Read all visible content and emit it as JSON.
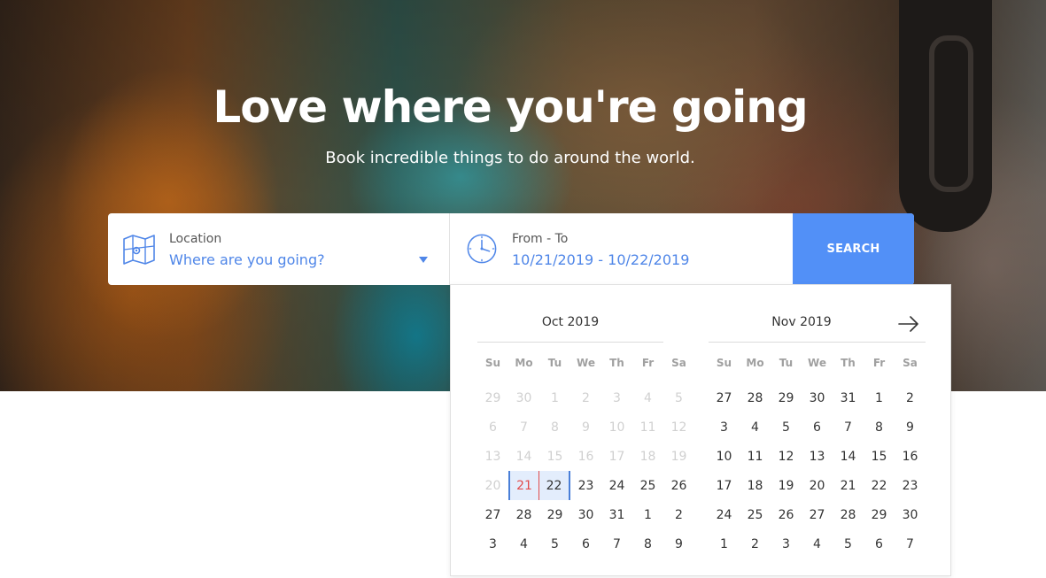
{
  "hero": {
    "title": "Love where you're going",
    "subtitle": "Book incredible things to do around the world."
  },
  "search": {
    "location_label": "Location",
    "location_placeholder": "Where are you going?",
    "location_icon": "map-icon",
    "dates_label": "From - To",
    "dates_value": "10/21/2019 - 10/22/2019",
    "dates_icon": "clock-icon",
    "button_label": "SEARCH"
  },
  "colors": {
    "accent": "#5290f7",
    "link": "#4f86e8",
    "range_background": "#e3edfc",
    "range_border": "#4a7fd8",
    "start_day_text": "#e24b4b"
  },
  "datepicker": {
    "next_icon": "arrow-right-icon",
    "weekdays": [
      "Su",
      "Mo",
      "Tu",
      "We",
      "Th",
      "Fr",
      "Sa"
    ],
    "months": [
      {
        "title": "Oct 2019",
        "days": [
          {
            "d": "29",
            "state": "muted"
          },
          {
            "d": "30",
            "state": "muted"
          },
          {
            "d": "1",
            "state": "muted"
          },
          {
            "d": "2",
            "state": "muted"
          },
          {
            "d": "3",
            "state": "muted"
          },
          {
            "d": "4",
            "state": "muted"
          },
          {
            "d": "5",
            "state": "muted"
          },
          {
            "d": "6",
            "state": "muted"
          },
          {
            "d": "7",
            "state": "muted"
          },
          {
            "d": "8",
            "state": "muted"
          },
          {
            "d": "9",
            "state": "muted"
          },
          {
            "d": "10",
            "state": "muted"
          },
          {
            "d": "11",
            "state": "muted"
          },
          {
            "d": "12",
            "state": "muted"
          },
          {
            "d": "13",
            "state": "muted"
          },
          {
            "d": "14",
            "state": "muted"
          },
          {
            "d": "15",
            "state": "muted"
          },
          {
            "d": "16",
            "state": "muted"
          },
          {
            "d": "17",
            "state": "muted"
          },
          {
            "d": "18",
            "state": "muted"
          },
          {
            "d": "19",
            "state": "muted"
          },
          {
            "d": "20",
            "state": "muted"
          },
          {
            "d": "21",
            "state": "start"
          },
          {
            "d": "22",
            "state": "end"
          },
          {
            "d": "23",
            "state": ""
          },
          {
            "d": "24",
            "state": ""
          },
          {
            "d": "25",
            "state": ""
          },
          {
            "d": "26",
            "state": ""
          },
          {
            "d": "27",
            "state": ""
          },
          {
            "d": "28",
            "state": ""
          },
          {
            "d": "29",
            "state": ""
          },
          {
            "d": "30",
            "state": ""
          },
          {
            "d": "31",
            "state": ""
          },
          {
            "d": "1",
            "state": ""
          },
          {
            "d": "2",
            "state": ""
          },
          {
            "d": "3",
            "state": ""
          },
          {
            "d": "4",
            "state": ""
          },
          {
            "d": "5",
            "state": ""
          },
          {
            "d": "6",
            "state": ""
          },
          {
            "d": "7",
            "state": ""
          },
          {
            "d": "8",
            "state": ""
          },
          {
            "d": "9",
            "state": ""
          }
        ]
      },
      {
        "title": "Nov 2019",
        "days": [
          {
            "d": "27",
            "state": ""
          },
          {
            "d": "28",
            "state": ""
          },
          {
            "d": "29",
            "state": ""
          },
          {
            "d": "30",
            "state": ""
          },
          {
            "d": "31",
            "state": ""
          },
          {
            "d": "1",
            "state": ""
          },
          {
            "d": "2",
            "state": ""
          },
          {
            "d": "3",
            "state": ""
          },
          {
            "d": "4",
            "state": ""
          },
          {
            "d": "5",
            "state": ""
          },
          {
            "d": "6",
            "state": ""
          },
          {
            "d": "7",
            "state": ""
          },
          {
            "d": "8",
            "state": ""
          },
          {
            "d": "9",
            "state": ""
          },
          {
            "d": "10",
            "state": ""
          },
          {
            "d": "11",
            "state": ""
          },
          {
            "d": "12",
            "state": ""
          },
          {
            "d": "13",
            "state": ""
          },
          {
            "d": "14",
            "state": ""
          },
          {
            "d": "15",
            "state": ""
          },
          {
            "d": "16",
            "state": ""
          },
          {
            "d": "17",
            "state": ""
          },
          {
            "d": "18",
            "state": ""
          },
          {
            "d": "19",
            "state": ""
          },
          {
            "d": "20",
            "state": ""
          },
          {
            "d": "21",
            "state": ""
          },
          {
            "d": "22",
            "state": ""
          },
          {
            "d": "23",
            "state": ""
          },
          {
            "d": "24",
            "state": ""
          },
          {
            "d": "25",
            "state": ""
          },
          {
            "d": "26",
            "state": ""
          },
          {
            "d": "27",
            "state": ""
          },
          {
            "d": "28",
            "state": ""
          },
          {
            "d": "29",
            "state": ""
          },
          {
            "d": "30",
            "state": ""
          },
          {
            "d": "1",
            "state": ""
          },
          {
            "d": "2",
            "state": ""
          },
          {
            "d": "3",
            "state": ""
          },
          {
            "d": "4",
            "state": ""
          },
          {
            "d": "5",
            "state": ""
          },
          {
            "d": "6",
            "state": ""
          },
          {
            "d": "7",
            "state": ""
          }
        ]
      }
    ]
  }
}
